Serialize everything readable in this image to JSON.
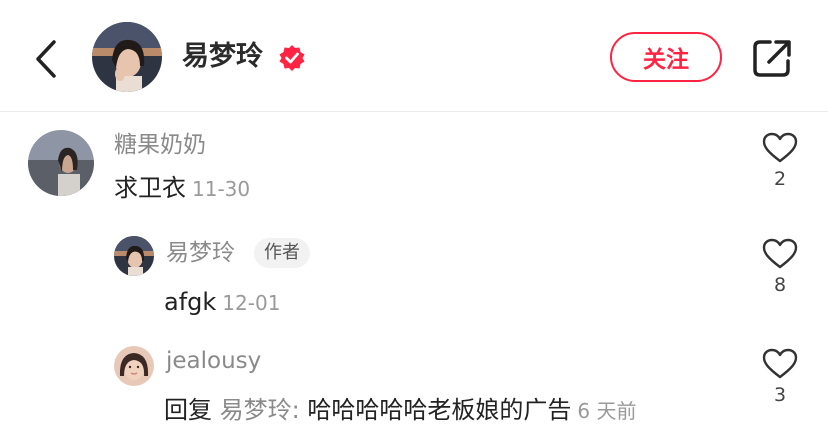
{
  "header": {
    "username": "易梦玲",
    "follow_label": "关注"
  },
  "comments": [
    {
      "author": "糖果奶奶",
      "text": "求卫衣",
      "date": "11-30",
      "likes": "2"
    },
    {
      "author": "易梦玲",
      "badge": "作者",
      "text": "afgk",
      "date": "12-01",
      "likes": "8"
    },
    {
      "author": "jealousy",
      "reply_prefix": "回复",
      "reply_to": "易梦玲:",
      "text": "哈哈哈哈哈老板娘的广告",
      "date": "6 天前",
      "likes": "3"
    }
  ],
  "colors": {
    "accent": "#ff2442",
    "secondary_text": "#8a8a8a",
    "divider": "#ececec"
  },
  "icons": {
    "back": "chevron-left-icon",
    "verified": "verified-badge-icon",
    "share": "share-icon",
    "like": "heart-outline-icon"
  }
}
